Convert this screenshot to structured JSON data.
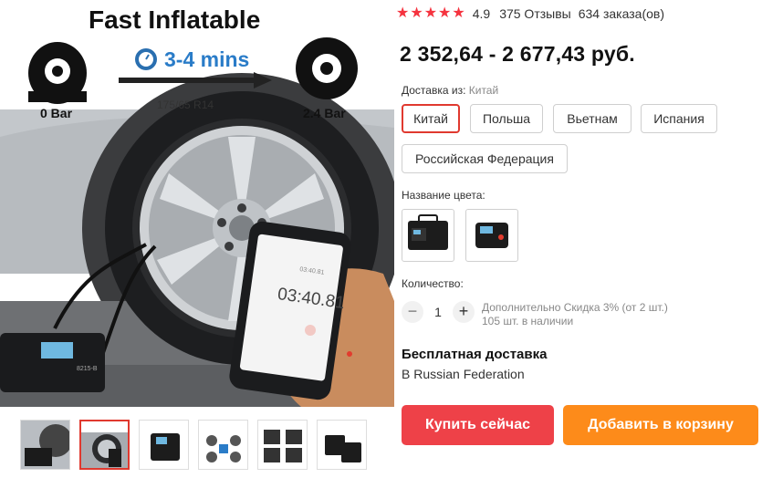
{
  "image": {
    "headline": "Fast Inflatable",
    "time_label": "3-4 mins",
    "start_pressure": "0 Bar",
    "end_pressure": "2.4 Bar",
    "tire_size": "175/65 R14",
    "phone_time": "03:40.81",
    "phone_time_small": "03:40.81",
    "device_model": "8215-B"
  },
  "thumbnails": [
    {
      "name": "thumb-1",
      "active": false
    },
    {
      "name": "thumb-2",
      "active": true
    },
    {
      "name": "thumb-3",
      "active": false
    },
    {
      "name": "thumb-4",
      "active": false
    },
    {
      "name": "thumb-5",
      "active": false
    },
    {
      "name": "thumb-6",
      "active": false
    }
  ],
  "rating": {
    "stars": 5,
    "value": "4.9",
    "reviews": "375 Отзывы",
    "orders": "634 заказа(ов)"
  },
  "price": "2 352,64 - 2 677,43 руб.",
  "shipping": {
    "label": "Доставка из: ",
    "from": "Китай",
    "options": [
      "Китай",
      "Польша",
      "Вьетнам",
      "Испания",
      "Российская Федерация"
    ],
    "selected": "Китай"
  },
  "color": {
    "label": "Название цвета:"
  },
  "quantity": {
    "label": "Количество:",
    "minus": "−",
    "value": "1",
    "plus": "+",
    "discount_note": "Дополнительно Скидка 3% (от 2 шт.)",
    "stock_note": "105 шт. в наличии"
  },
  "delivery": {
    "title": "Бесплатная доставка",
    "destination": "В Russian Federation"
  },
  "actions": {
    "buy_now": "Купить сейчас",
    "add_to_cart": "Добавить в корзину"
  },
  "colors": {
    "accent_red": "#e0392f",
    "star_red": "#f5333f",
    "buy_button": "#ee4148",
    "cart_button": "#fd8b1a"
  }
}
